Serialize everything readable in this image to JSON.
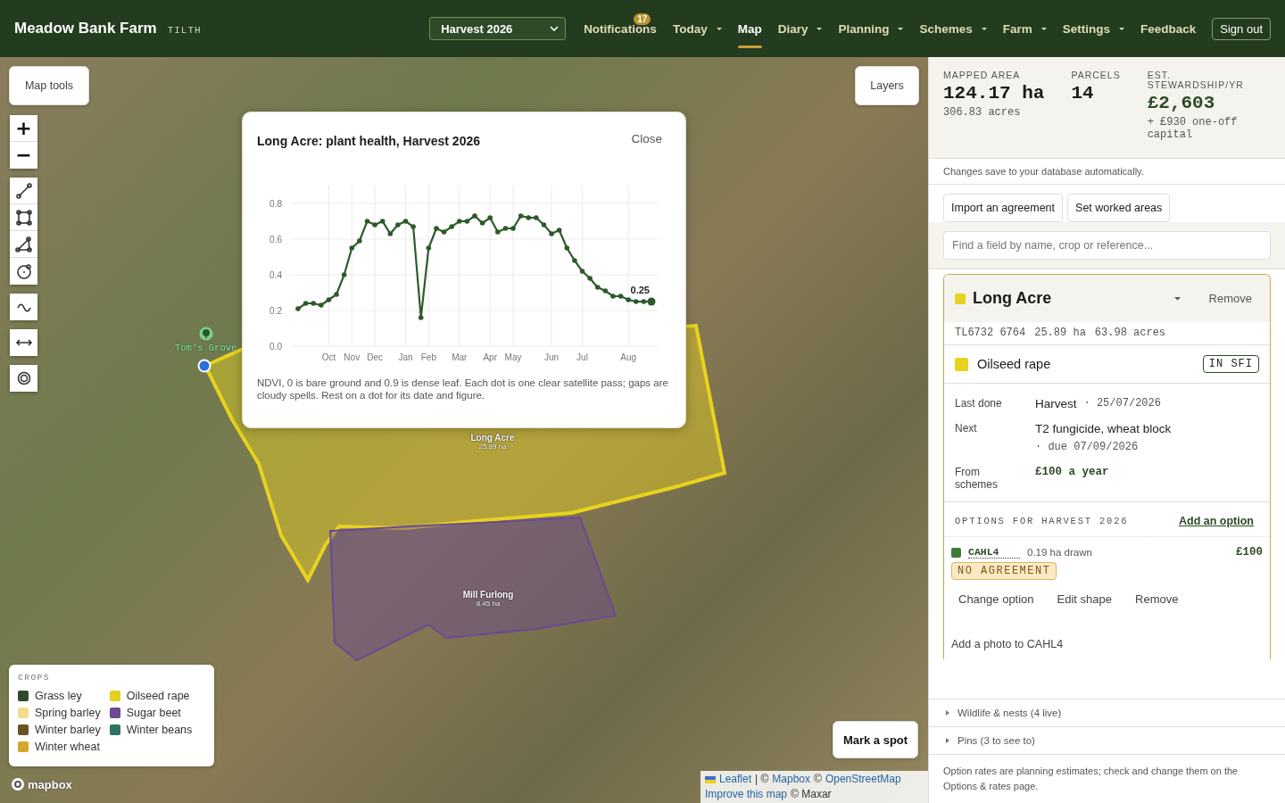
{
  "header": {
    "title": "Meadow Bank Farm",
    "subtitle": "TILTH",
    "season_select": {
      "value": "Harvest 2026"
    },
    "nav": [
      {
        "label": "Notifications",
        "badge": "17",
        "dropdown": false,
        "selected": false
      },
      {
        "label": "Today",
        "dropdown": true,
        "selected": false
      },
      {
        "label": "Map",
        "dropdown": false,
        "selected": true
      },
      {
        "label": "Diary",
        "dropdown": true,
        "selected": false
      },
      {
        "label": "Planning",
        "dropdown": true,
        "selected": false
      },
      {
        "label": "Schemes",
        "dropdown": true,
        "selected": false
      },
      {
        "label": "Farm",
        "dropdown": true,
        "selected": false
      },
      {
        "label": "Settings",
        "dropdown": true,
        "selected": false
      },
      {
        "label": "Feedback",
        "dropdown": false,
        "selected": false
      }
    ],
    "sign_out": "Sign out"
  },
  "map": {
    "tools_button": "Map tools",
    "layers_button": "Layers",
    "zoom_in": "+",
    "zoom_out": "−",
    "fields": [
      {
        "name": "Long Acre",
        "area": "25.89 ha",
        "color": "#e8d21e",
        "selected": true
      },
      {
        "name": "Mill Furlong",
        "area": "8.45 ha",
        "color": "#6a4a93",
        "selected": false
      }
    ],
    "marker": {
      "label": "Tom's Grove"
    },
    "legend": {
      "title": "CROPS",
      "items": [
        {
          "label": "Grass ley",
          "color": "#2f4a2c"
        },
        {
          "label": "Spring barley",
          "color": "#f0dc90"
        },
        {
          "label": "Winter barley",
          "color": "#6b5222"
        },
        {
          "label": "Winter wheat",
          "color": "#d4a72c"
        },
        {
          "label": "Oilseed rape",
          "color": "#e6cf1e"
        },
        {
          "label": "Sugar beet",
          "color": "#6a4a93"
        },
        {
          "label": "Winter beans",
          "color": "#2e7466"
        }
      ]
    },
    "mark_spot_button": "Mark a spot",
    "logo": "mapbox",
    "attribution": [
      {
        "kind": "link",
        "text": "Leaflet"
      },
      {
        "kind": "text",
        "text": "| ©"
      },
      {
        "kind": "link",
        "text": "Mapbox"
      },
      {
        "kind": "text",
        "text": "©"
      },
      {
        "kind": "link",
        "text": "OpenStreetMap"
      },
      {
        "kind": "break"
      },
      {
        "kind": "link",
        "text": "Improve this map"
      },
      {
        "kind": "text",
        "text": "© Maxar"
      }
    ]
  },
  "popup": {
    "title": "Long Acre: plant health, Harvest 2026",
    "close": "Close",
    "chart_data": {
      "type": "line",
      "grid": true,
      "series": [
        {
          "color": "#2d5a2a",
          "values": [
            0.21,
            0.24,
            0.24,
            0.23,
            0.26,
            0.29,
            0.4,
            0.55,
            0.59,
            0.7,
            0.68,
            0.7,
            0.63,
            0.68,
            0.7,
            0.67,
            0.16,
            0.55,
            0.66,
            0.64,
            0.67,
            0.7,
            0.7,
            0.73,
            0.69,
            0.72,
            0.64,
            0.66,
            0.66,
            0.73,
            0.72,
            0.72,
            0.68,
            0.63,
            0.65,
            0.55,
            0.48,
            0.42,
            0.38,
            0.33,
            0.31,
            0.28,
            0.28,
            0.26,
            0.25,
            0.25,
            0.25
          ]
        }
      ],
      "ylim": [
        0,
        0.9
      ],
      "categories": [
        null,
        null,
        null,
        null,
        "Oct",
        null,
        null,
        "Nov",
        null,
        null,
        "Dec",
        null,
        null,
        null,
        "Jan",
        null,
        null,
        "Feb",
        null,
        null,
        null,
        "Mar",
        null,
        null,
        null,
        "Apr",
        null,
        null,
        "May",
        null,
        null,
        null,
        null,
        "Jun",
        null,
        null,
        null,
        "Jul",
        null,
        null,
        null,
        null,
        null,
        "Aug",
        null,
        null,
        null
      ],
      "yticks": [
        {
          "value": 0,
          "label": "0.0"
        },
        {
          "value": 0.2,
          "label": "0.2"
        },
        {
          "value": 0.4,
          "label": "0.4"
        },
        {
          "value": 0.6,
          "label": "0.6"
        },
        {
          "value": 0.8,
          "label": "0.8"
        }
      ],
      "annotations": [
        {
          "text": "0.25"
        }
      ]
    },
    "caption": "NDVI, 0 is bare ground and 0.9 is dense leaf. Each dot is one clear satellite pass; gaps are cloudy spells. Rest on a dot for its date and figure."
  },
  "panel": {
    "stats": [
      {
        "label": "MAPPED AREA",
        "value": "124.17 ha",
        "sub": "306.83 acres",
        "kind": "plain"
      },
      {
        "label": "PARCELS",
        "value": "14",
        "kind": "plain"
      },
      {
        "label": "EST. STEWARDSHIP/YR",
        "value": "£2,603",
        "sub": "+ £930 one-off capital",
        "kind": "money"
      }
    ],
    "notice": "Changes save to your database automatically.",
    "buttons": [
      "Import an agreement",
      "Set worked areas"
    ],
    "search": {
      "placeholder": "Find a field by name, crop or reference..."
    },
    "field": {
      "name": "Long Acre",
      "color": "#e8d21e",
      "remove": "Remove",
      "refs": [
        "TL6732 6764",
        "25.89 ha",
        "63.98 acres"
      ],
      "crop": {
        "name": "Oilseed rape",
        "color": "#e8d21e",
        "badge": "IN SFI"
      },
      "details": [
        {
          "label": "Last done",
          "value": "Harvest",
          "meta": "· 25/07/2026",
          "kind": "event"
        },
        {
          "label": "Next",
          "value": "T2 fungicide, wheat block",
          "meta": "· due 07/09/2026",
          "kind": "event"
        },
        {
          "label": "From schemes",
          "value": "£100 a year",
          "kind": "money"
        }
      ],
      "options_title": "OPTIONS FOR HARVEST 2026",
      "add_option": "Add an option",
      "options": [
        {
          "code": "CAHL4",
          "color": "#3f7a36",
          "area": "0.19 ha drawn",
          "amount": "£100",
          "status": "NO AGREEMENT",
          "actions": [
            "Change option",
            "Edit shape",
            "Remove"
          ],
          "add_photo": "Add a photo to CAHL4"
        }
      ]
    },
    "sections": [
      {
        "label": "Wildlife & nests (4 live)",
        "expanded": false
      },
      {
        "label": "Pins (3 to see to)",
        "expanded": false
      }
    ],
    "footnote": "Option rates are planning estimates; check and change them on the Options & rates page."
  }
}
